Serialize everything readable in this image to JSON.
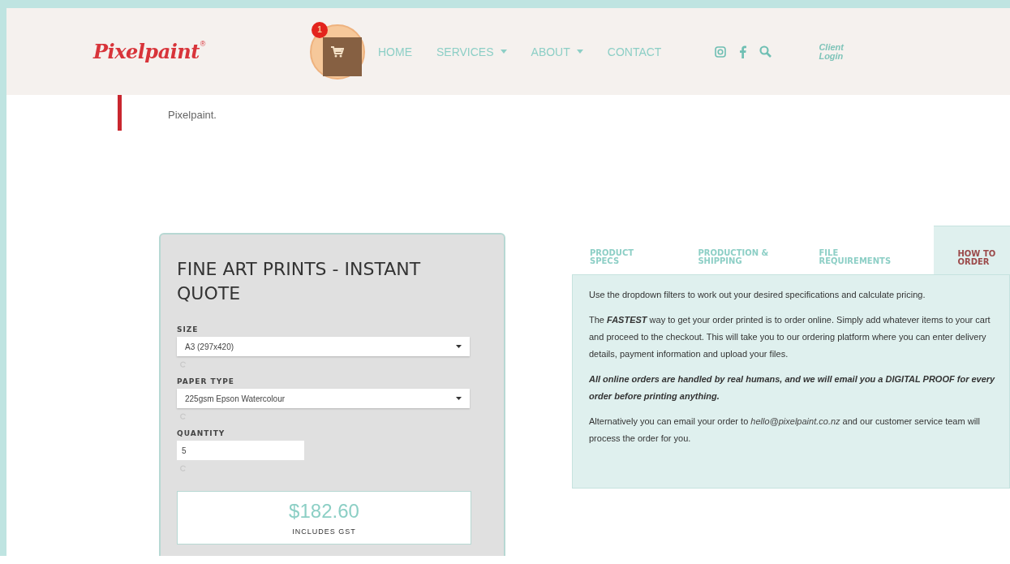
{
  "header": {
    "logo": "Pixelpaint",
    "logo_mark": "®",
    "cart": {
      "count": "1"
    },
    "nav": [
      {
        "label": "HOME",
        "dropdown": false
      },
      {
        "label": "SERVICES",
        "dropdown": true
      },
      {
        "label": "ABOUT",
        "dropdown": true
      },
      {
        "label": "CONTACT",
        "dropdown": false
      }
    ],
    "client_login": "Client Login"
  },
  "quote_text": "Pixelpaint.",
  "quote_card": {
    "title": "FINE ART PRINTS - INSTANT QUOTE",
    "fields": [
      {
        "label": "SIZE",
        "kind": "select",
        "value": "A3 (297x420)"
      },
      {
        "label": "PAPER TYPE",
        "kind": "select",
        "value": "225gsm Epson Watercolour"
      },
      {
        "label": "QUANTITY",
        "kind": "number",
        "value": "5"
      }
    ],
    "price": "$182.60",
    "price_note": "INCLUDES GST"
  },
  "tabs": [
    {
      "label": "PRODUCT SPECS",
      "selected": false
    },
    {
      "label": "PRODUCTION & SHIPPING",
      "selected": false
    },
    {
      "label": "FILE REQUIREMENTS",
      "selected": false
    },
    {
      "label": "HOW TO ORDER",
      "selected": true
    }
  ],
  "tab_content": [
    {
      "kind": "text",
      "text": "Use the dropdown filters to work out your desired specifications and calculate pricing."
    },
    {
      "kind": "text",
      "text": "The **FASTEST** way to get your order printed is to order online. Simply add whatever items to your cart and proceed to the checkout. This will take you to our ordering platform where you can enter delivery details, payment information and upload your files."
    },
    {
      "kind": "emphasis",
      "text": "All online orders are handled by real humans, and we will email you a DIGITAL PROOF for every order before printing anything."
    },
    {
      "kind": "email",
      "before": "Alternatively you can email your order to ",
      "email": "hello@pixelpaint.co.nz",
      "after": " and our customer service team will process the order for you."
    }
  ]
}
